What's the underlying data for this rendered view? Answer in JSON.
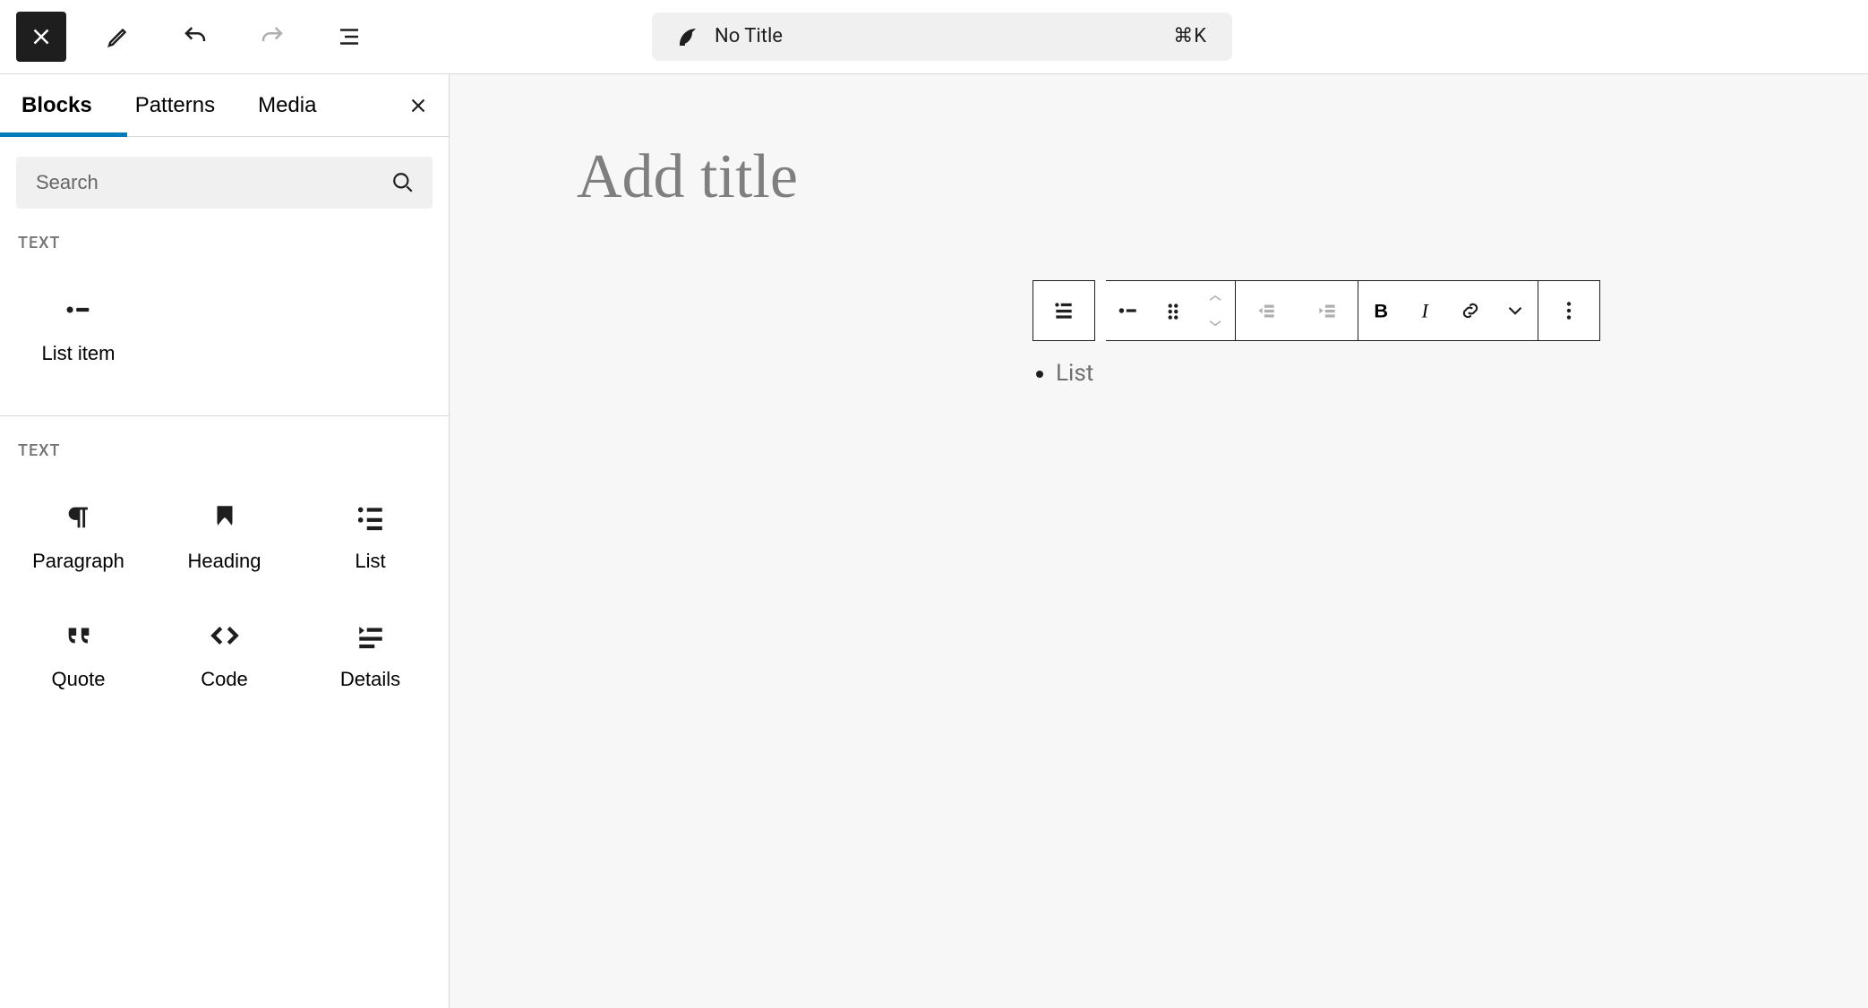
{
  "topbar": {
    "doc_title": "No Title",
    "kbd_hint": "⌘K"
  },
  "inserter": {
    "tabs": [
      "Blocks",
      "Patterns",
      "Media"
    ],
    "active_tab": 0,
    "search_placeholder": "Search",
    "sections": [
      {
        "label": "TEXT",
        "items": [
          {
            "name": "List item",
            "icon": "list-item"
          }
        ]
      },
      {
        "label": "TEXT",
        "items": [
          {
            "name": "Paragraph",
            "icon": "paragraph"
          },
          {
            "name": "Heading",
            "icon": "heading"
          },
          {
            "name": "List",
            "icon": "list"
          },
          {
            "name": "Quote",
            "icon": "quote"
          },
          {
            "name": "Code",
            "icon": "code"
          },
          {
            "name": "Details",
            "icon": "details"
          }
        ]
      }
    ]
  },
  "editor": {
    "title_placeholder": "Add title",
    "list_placeholder": "List"
  }
}
